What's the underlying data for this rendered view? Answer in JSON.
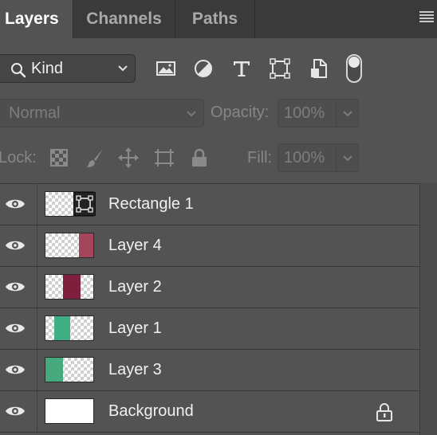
{
  "tabs": [
    {
      "label": "Layers",
      "active": true
    },
    {
      "label": "Channels",
      "active": false
    },
    {
      "label": "Paths",
      "active": false
    }
  ],
  "filter": {
    "kind_label": "Kind",
    "icons": [
      "image-filter-icon",
      "adjustment-filter-icon",
      "type-filter-icon",
      "shape-filter-icon",
      "smart-object-filter-icon"
    ],
    "filter_toggle_on": true
  },
  "blend": {
    "mode": "Normal",
    "opacity_label": "Opacity:",
    "opacity_value": "100%"
  },
  "lock": {
    "label": "Lock:",
    "fill_label": "Fill:",
    "fill_value": "100%"
  },
  "layers": [
    {
      "name": "Rectangle 1",
      "visible": true,
      "kind": "shape"
    },
    {
      "name": "Layer 4",
      "visible": true,
      "fill_color": "#a5455c"
    },
    {
      "name": "Layer 2",
      "visible": true,
      "fill_color": "#7e1f3d"
    },
    {
      "name": "Layer 1",
      "visible": true,
      "fill_color": "#3fae83"
    },
    {
      "name": "Layer 3",
      "visible": true,
      "fill_color": "#46a97d"
    },
    {
      "name": "Background",
      "visible": true,
      "locked": true
    }
  ],
  "colors": {
    "panel_bg": "#535353",
    "tabbar_bg": "#3a3a3a",
    "text": "#f1f1f1"
  }
}
